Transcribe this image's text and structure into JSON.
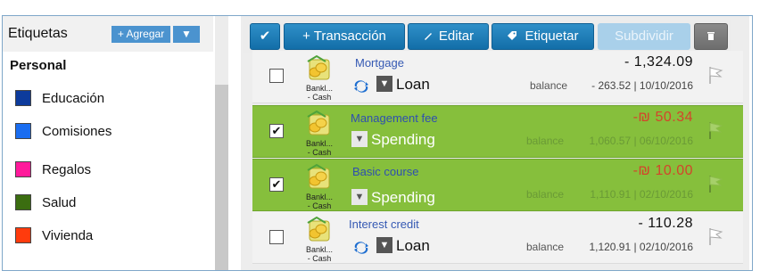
{
  "sidebar": {
    "title": "Etiquetas",
    "add_label": "+ Agregar",
    "dropdown_label": "▼",
    "group_heading": "Personal",
    "tags": [
      {
        "label": "Educación",
        "color": "#0d3b9c"
      },
      {
        "label": "Comisiones",
        "color": "#1a6df0"
      },
      {
        "label": "Regalos",
        "color": "#ff1a9b"
      },
      {
        "label": "Salud",
        "color": "#3b6d10"
      },
      {
        "label": "Vivienda",
        "color": "#ff3b0d"
      }
    ]
  },
  "toolbar": {
    "check_label": "✔",
    "add_label": "+ Transacción",
    "edit_label": "Editar",
    "tag_label": "Etiquetar",
    "split_label": "Subdividir",
    "delete_icon": "trash-icon"
  },
  "transactions": [
    {
      "checked": false,
      "check_mark": "",
      "account": "Bankl...\n- Cash",
      "payee": "Mortgage",
      "category": "Loan",
      "amount": "- 1,324.09",
      "balance_label": "balance",
      "balance": "- 263.52 | 10/10/2016",
      "recurring": true
    },
    {
      "checked": true,
      "check_mark": "✔",
      "account": "Bankl...\n- Cash",
      "payee": "Management fee",
      "category": "Spending",
      "amount": "-₪ 50.34",
      "balance_label": "balance",
      "balance": "1,060.57 | 06/10/2016",
      "recurring": false
    },
    {
      "checked": true,
      "check_mark": "✔",
      "account": "Bankl...\n- Cash",
      "payee": "Basic course",
      "category": "Spending",
      "amount": "-₪ 10.00",
      "balance_label": "balance",
      "balance": "1,110.91 | 02/10/2016",
      "recurring": false
    },
    {
      "checked": false,
      "check_mark": "",
      "account": "Bankl...\n- Cash",
      "payee": "Interest credit",
      "category": "Loan",
      "amount": "- 110.28",
      "balance_label": "balance",
      "balance": "1,120.91 | 02/10/2016",
      "recurring": true
    }
  ],
  "colors": {
    "accent": "#2f8fc8",
    "selected_row": "#86bf3c",
    "negative_amount": "#d3452b"
  }
}
